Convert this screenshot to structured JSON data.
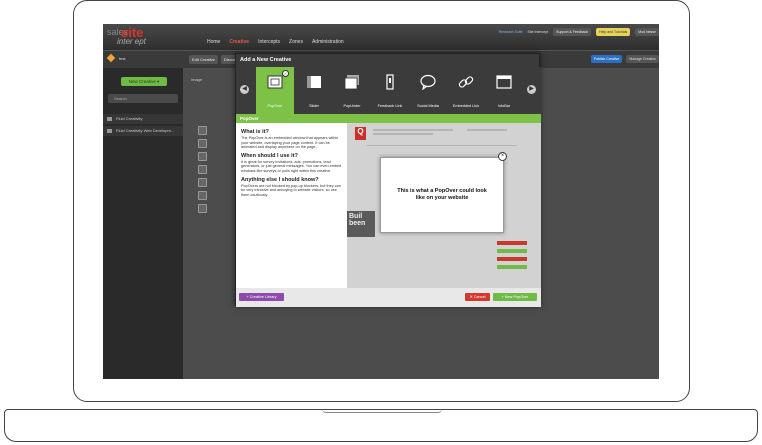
{
  "app": {
    "logo_top": "sales",
    "logo_main": "site",
    "logo_bottom": "inter ept",
    "nav": [
      "Home",
      "Creative",
      "Intercepts",
      "Zones",
      "Administration"
    ],
    "active_nav": "Creative",
    "header_links": [
      "Research Suite",
      "Site Intercept"
    ],
    "header_buttons": [
      "Support & Feedback",
      "Help and Tutorials",
      "Mod Nesse"
    ]
  },
  "toolbar": {
    "site": "test",
    "middle": [
      "Edit Creative",
      "Discuss"
    ],
    "right": [
      "Publish Creative",
      "Manage Creative"
    ]
  },
  "sidebar": {
    "new_creative": "New Creative ▾",
    "search_placeholder": "Search",
    "items": [
      "Fluid Creativity",
      "Fluid Creativity Web Developm..."
    ]
  },
  "workspace": {
    "image_label": "Image"
  },
  "modal": {
    "title": "Add a New Creative",
    "types": [
      {
        "label": "PopOver",
        "icon": "popover-icon"
      },
      {
        "label": "Slider",
        "icon": "slider-icon"
      },
      {
        "label": "PopUnder",
        "icon": "popunder-icon"
      },
      {
        "label": "Feedback Link",
        "icon": "feedback-link-icon"
      },
      {
        "label": "Social Media",
        "icon": "speech-bubble-icon"
      },
      {
        "label": "Embedded Link",
        "icon": "link-icon"
      },
      {
        "label": "InfoBar",
        "icon": "infobar-icon"
      }
    ],
    "selected_type": "PopOver",
    "section_title": "PopOver",
    "info": {
      "q1": "What is it?",
      "a1": "The PopOver is an embedded window that appears within your website, overlaying your page content. It can be animated and display anywhere on the page.",
      "q2": "When should I use it?",
      "a2": "It is great for survey invitations, ads, promotions, lead generators, or just general messages. You can even embed windows like surveys or polls right within this creative.",
      "q3": "Anything else I should know?",
      "a3": "PopOvers are not blocked by pop-up blockers, but they can be very intrusive and annoying to website visitors, so use them cautiously."
    },
    "preview": {
      "popover_text": "This is what a PopOver could look like on your website",
      "bg_text": "Buil been",
      "logo_letter": "Q"
    },
    "footer": {
      "library": "+ Creative Library",
      "cancel": "✕ Cancel",
      "new": "+ New PopOver"
    }
  },
  "colors": {
    "accent_green": "#7dc247",
    "danger_red": "#d33a2f",
    "library_purple": "#8d4bab",
    "publish_blue": "#2b6fc4"
  }
}
